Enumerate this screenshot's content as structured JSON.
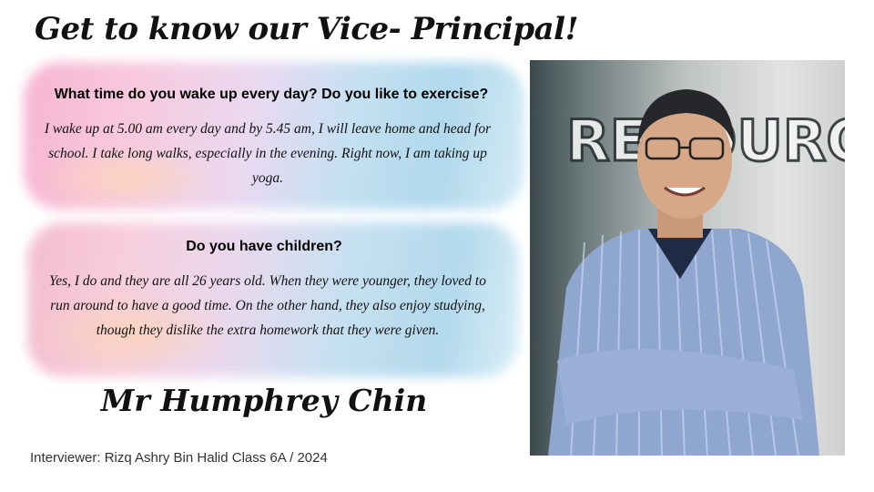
{
  "slide": {
    "title": "Get to know our Vice- Principal!",
    "question1": "What time  do you wake up every day?  Do you like to exercise?",
    "answer1": "I wake up at 5.00 am every day and by 5.45 am, I will leave home and head for school. I take long walks, especially in the evening. Right now, I am taking up yoga.",
    "question2": "Do you have children?",
    "answer2": "Yes, I do and they are all 26 years old. When they were younger, they loved to run around to have a good time. On the other hand, they also enjoy studying, though they dislike the extra homework that they were given.",
    "name": "Mr Humphrey Chin",
    "interviewer": "Interviewer:  Rizq Ashry Bin Halid Class 6A / 2024"
  },
  "photo": {
    "sign_text": "RESOURCE"
  }
}
